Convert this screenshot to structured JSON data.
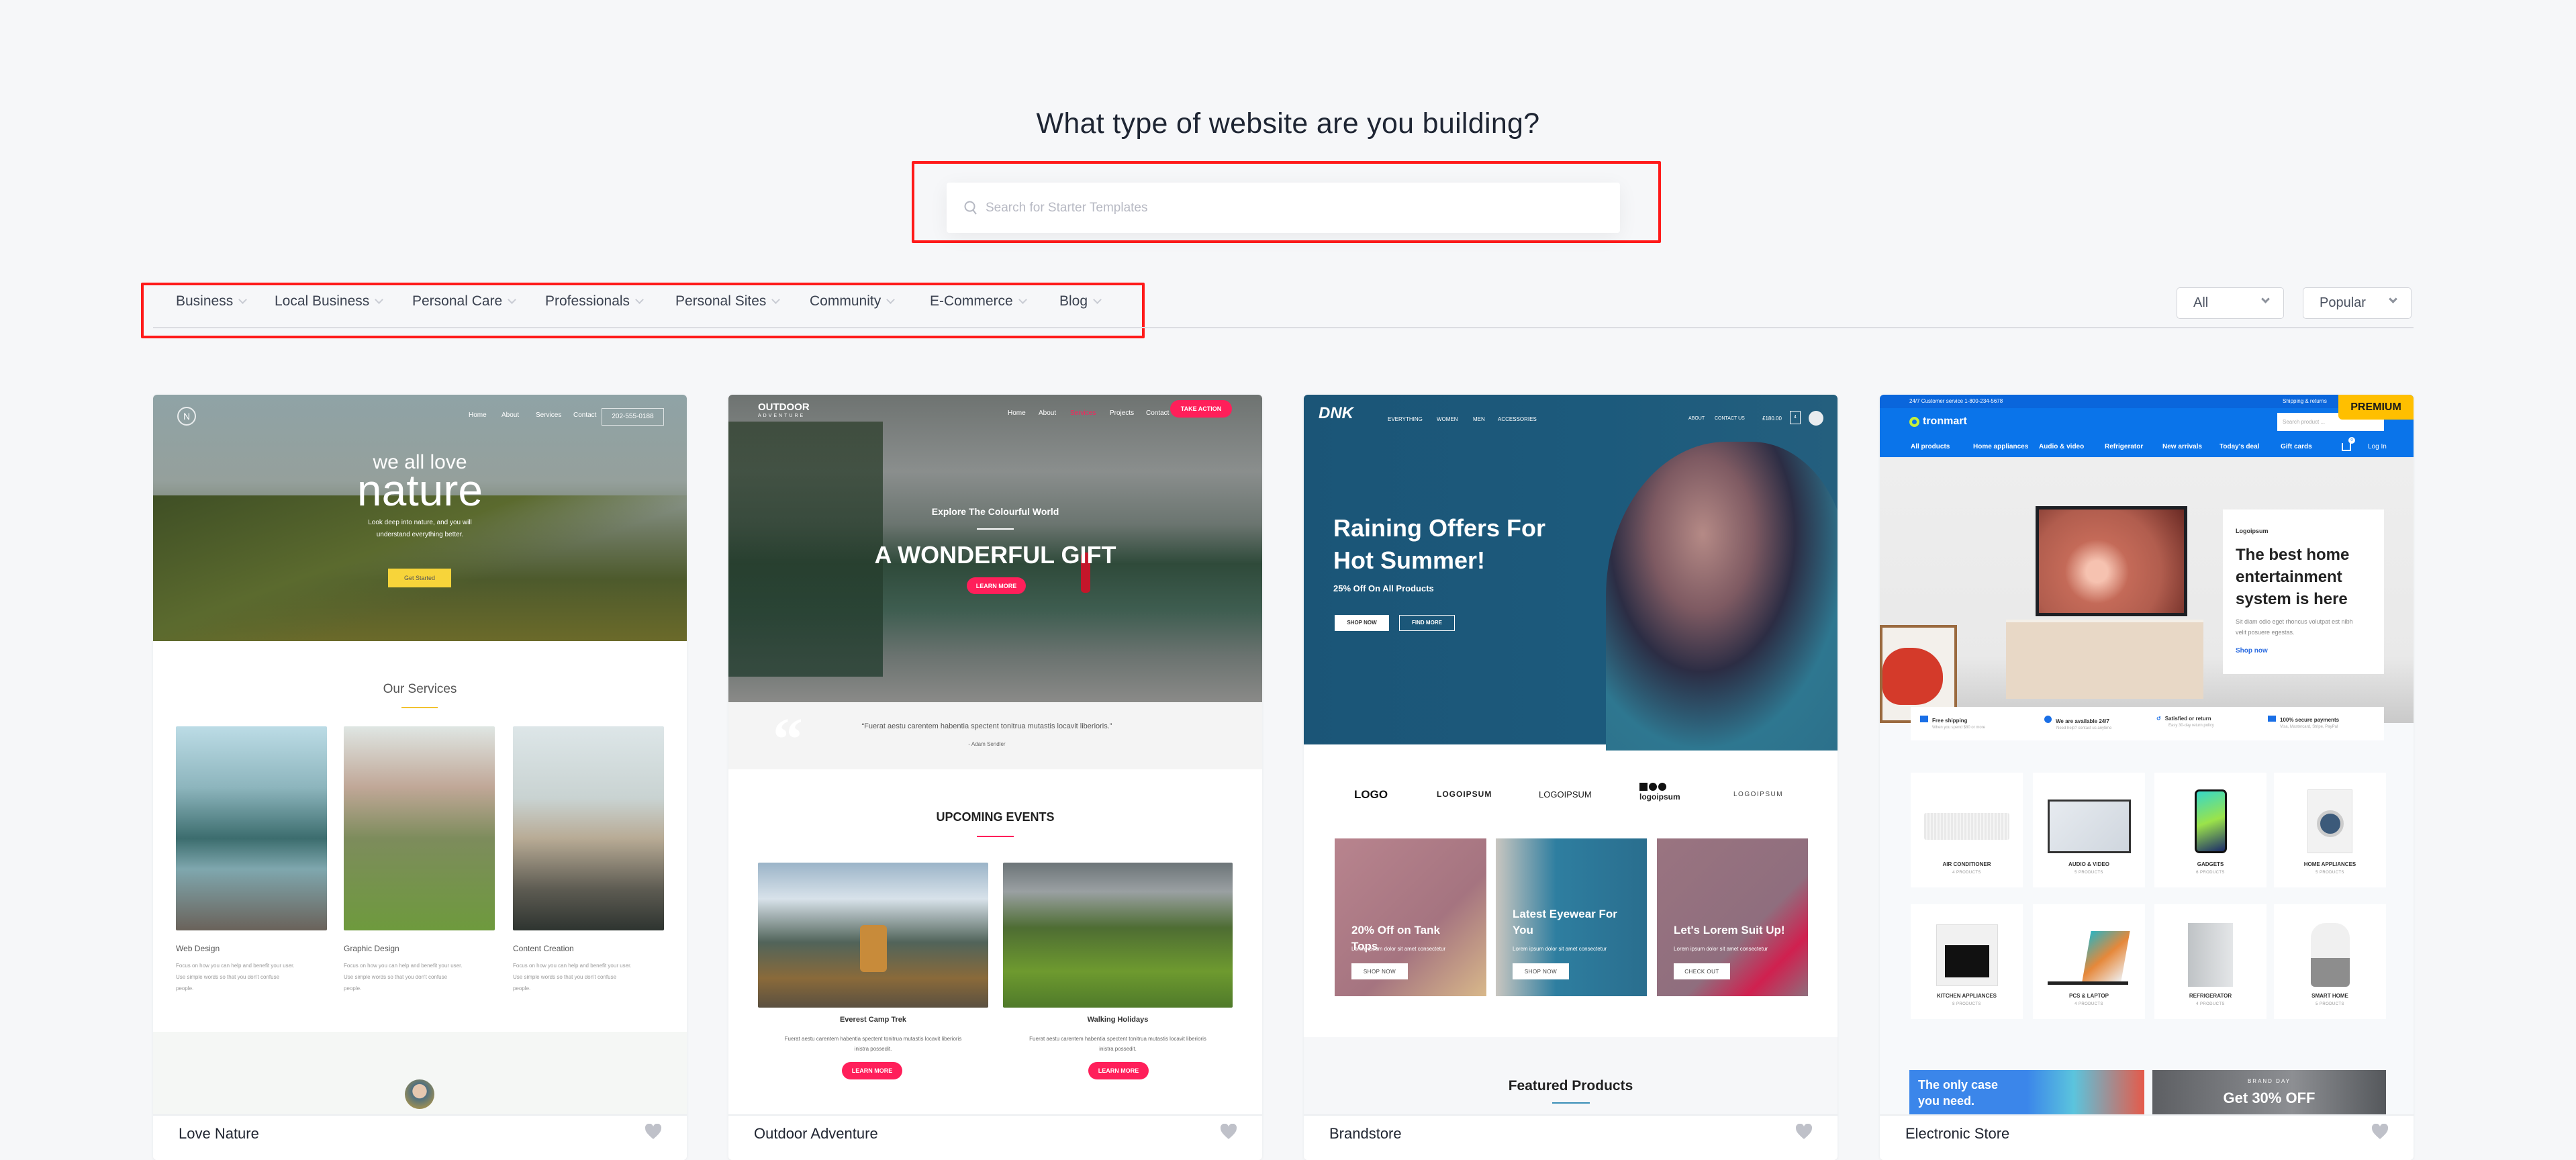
{
  "header": {
    "title": "What type of website are you building?"
  },
  "search": {
    "placeholder": "Search for Starter Templates",
    "icon": "search-icon"
  },
  "categories": [
    {
      "label": "Business"
    },
    {
      "label": "Local Business"
    },
    {
      "label": "Personal Care"
    },
    {
      "label": "Professionals"
    },
    {
      "label": "Personal Sites"
    },
    {
      "label": "Community"
    },
    {
      "label": "E-Commerce"
    },
    {
      "label": "Blog"
    }
  ],
  "filters": {
    "type": "All",
    "sort": "Popular"
  },
  "colors": {
    "annotation": "#ff1a1a",
    "accent_pink": "#ff1f5a",
    "premium": "#ffbf00",
    "tronmart_blue": "#0a74ea",
    "dnk_blue": "#1b5577"
  },
  "cards": [
    {
      "name": "Love Nature",
      "favorite_icon": "heart-icon",
      "preview": {
        "logo": "N",
        "nav": [
          "Home",
          "About",
          "Services",
          "Contact"
        ],
        "phone": "202-555-0188",
        "hero_small": "we all love",
        "hero_big": "nature",
        "hero_text": [
          "Look deep into nature, and you will",
          "understand everything better."
        ],
        "cta": "Get Started",
        "section_title": "Our Services",
        "services": [
          {
            "title": "Web Design",
            "desc": [
              "Focus on how you can help and benefit your user.",
              "Use simple words so that you don't confuse",
              "people."
            ]
          },
          {
            "title": "Graphic Design",
            "desc": [
              "Focus on how you can help and benefit your user.",
              "Use simple words so that you don't confuse",
              "people."
            ]
          },
          {
            "title": "Content Creation",
            "desc": [
              "Focus on how you can help and benefit your user.",
              "Use simple words so that you don't confuse",
              "people."
            ]
          }
        ]
      }
    },
    {
      "name": "Outdoor Adventure",
      "favorite_icon": "heart-icon",
      "preview": {
        "logo_top": "OUTDOOR",
        "logo_bottom": "ADVENTURE",
        "nav": [
          "Home",
          "About",
          "Services",
          "Projects",
          "Contact"
        ],
        "nav_cta": "TAKE ACTION",
        "kicker": "Explore The Colourful World",
        "hero": "A WONDERFUL GIFT",
        "cta": "LEARN MORE",
        "quote": "“Fuerat aestu carentem habentia spectent tonitrua mutastis locavit liberioris.”",
        "quote_author": "- Adam Sendler",
        "section_title": "UPCOMING EVENTS",
        "events": [
          {
            "title": "Everest Camp Trek",
            "desc": [
              "Fuerat aestu carentem habentia spectent tonitrua mutastis locavit liberioris",
              "inistra possedit."
            ],
            "cta": "LEARN MORE"
          },
          {
            "title": "Walking Holidays",
            "desc": [
              "Fuerat aestu carentem habentia spectent tonitrua mutastis locavit liberioris",
              "inistra possedit."
            ],
            "cta": "LEARN MORE"
          }
        ]
      }
    },
    {
      "name": "Brandstore",
      "favorite_icon": "heart-icon",
      "preview": {
        "logo": "DNK",
        "nav": [
          "EVERYTHING",
          "WOMEN",
          "MEN",
          "ACCESSORIES"
        ],
        "nav_right": [
          "ABOUT",
          "CONTACT US"
        ],
        "cart_total": "£180.00",
        "cart_count": "4",
        "hero": [
          "Raining Offers For",
          "Hot Summer!"
        ],
        "hero_sub": "25% Off On All Products",
        "btn_primary": "SHOP NOW",
        "btn_secondary": "FIND MORE",
        "logos": [
          "LOGO",
          "LOGOIPSUM",
          "LOGOIPSUM",
          "logoipsum",
          "LOGOIPSUM"
        ],
        "tiles": [
          {
            "title": "20% Off on Tank Tops",
            "desc": "Lorem ipsum dolor sit amet consectetur",
            "cta": "SHOP NOW"
          },
          {
            "title": "Latest Eyewear For You",
            "desc": "Lorem ipsum dolor sit amet consectetur",
            "cta": "SHOP NOW"
          },
          {
            "title": "Let's Lorem Suit Up!",
            "desc": "Lorem ipsum dolor sit amet consectetur",
            "cta": "CHECK OUT"
          }
        ],
        "section_title": "Featured Products"
      }
    },
    {
      "name": "Electronic Store",
      "badge": "PREMIUM",
      "favorite_icon": "heart-icon",
      "preview": {
        "topbar_left": "24/7 Customer service 1-800-234-5678",
        "topbar_right": "Shipping & returns",
        "logo": "tronmart",
        "search_placeholder": "Search product ...",
        "nav": [
          "All products",
          "Home appliances",
          "Audio & video",
          "Refrigerator",
          "New arrivals",
          "Today's deal",
          "Gift cards"
        ],
        "cart_count": "0",
        "login": "Log In",
        "promo_brand": "Logoipsum",
        "promo_title": [
          "The best home",
          "entertainment",
          "system is here"
        ],
        "promo_text": [
          "Sit diam odio eget rhoncus volutpat est nibh",
          "velit posuere egestas."
        ],
        "promo_cta": "Shop now",
        "features": [
          {
            "title": "Free shipping",
            "desc": "When you spend $80 or more"
          },
          {
            "title": "We are available 24/7",
            "desc": "Need help? contact us anytime"
          },
          {
            "title": "Satisfied or return",
            "desc": "Easy 30-day return policy"
          },
          {
            "title": "100% secure payments",
            "desc": "Visa, Mastercard, Stripe, PayPal"
          }
        ],
        "categories": [
          {
            "label": "AIR CONDITIONER",
            "count": "4 PRODUCTS"
          },
          {
            "label": "AUDIO & VIDEO",
            "count": "5 PRODUCTS"
          },
          {
            "label": "GADGETS",
            "count": "6 PRODUCTS"
          },
          {
            "label": "HOME APPLIANCES",
            "count": "5 PRODUCTS"
          },
          {
            "label": "KITCHEN APPLIANCES",
            "count": "8 PRODUCTS"
          },
          {
            "label": "PCS & LAPTOP",
            "count": "4 PRODUCTS"
          },
          {
            "label": "REFRIGERATOR",
            "count": "4 PRODUCTS"
          },
          {
            "label": "SMART HOME",
            "count": "5 PRODUCTS"
          }
        ],
        "banner_left": [
          "The only case",
          "you need."
        ],
        "banner_right_kicker": "BRAND DAY",
        "banner_right": "Get 30% OFF"
      }
    }
  ]
}
